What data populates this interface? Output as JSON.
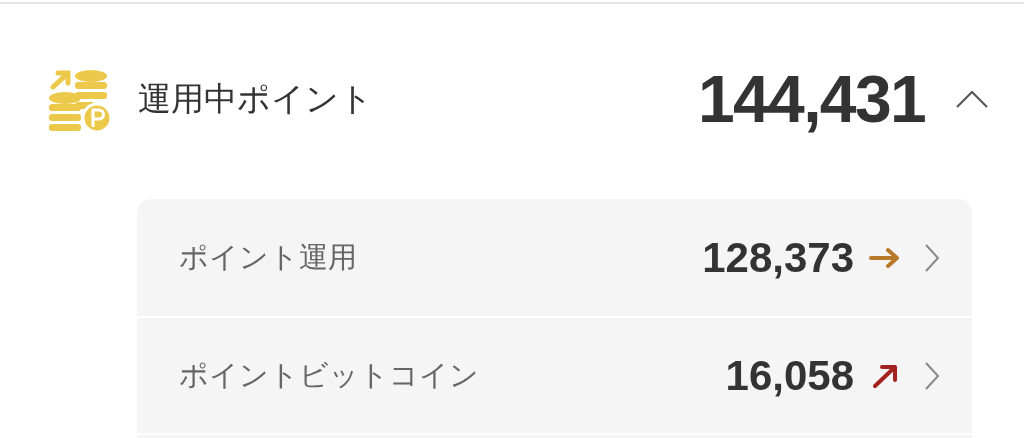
{
  "section": {
    "title": "運用中ポイント",
    "total": "144,431",
    "expanded": true,
    "rows": [
      {
        "label": "ポイント運用",
        "value": "128,373",
        "kind": "flat"
      },
      {
        "label": "ポイントビットコイン",
        "value": "16,058",
        "kind": "up"
      }
    ]
  }
}
